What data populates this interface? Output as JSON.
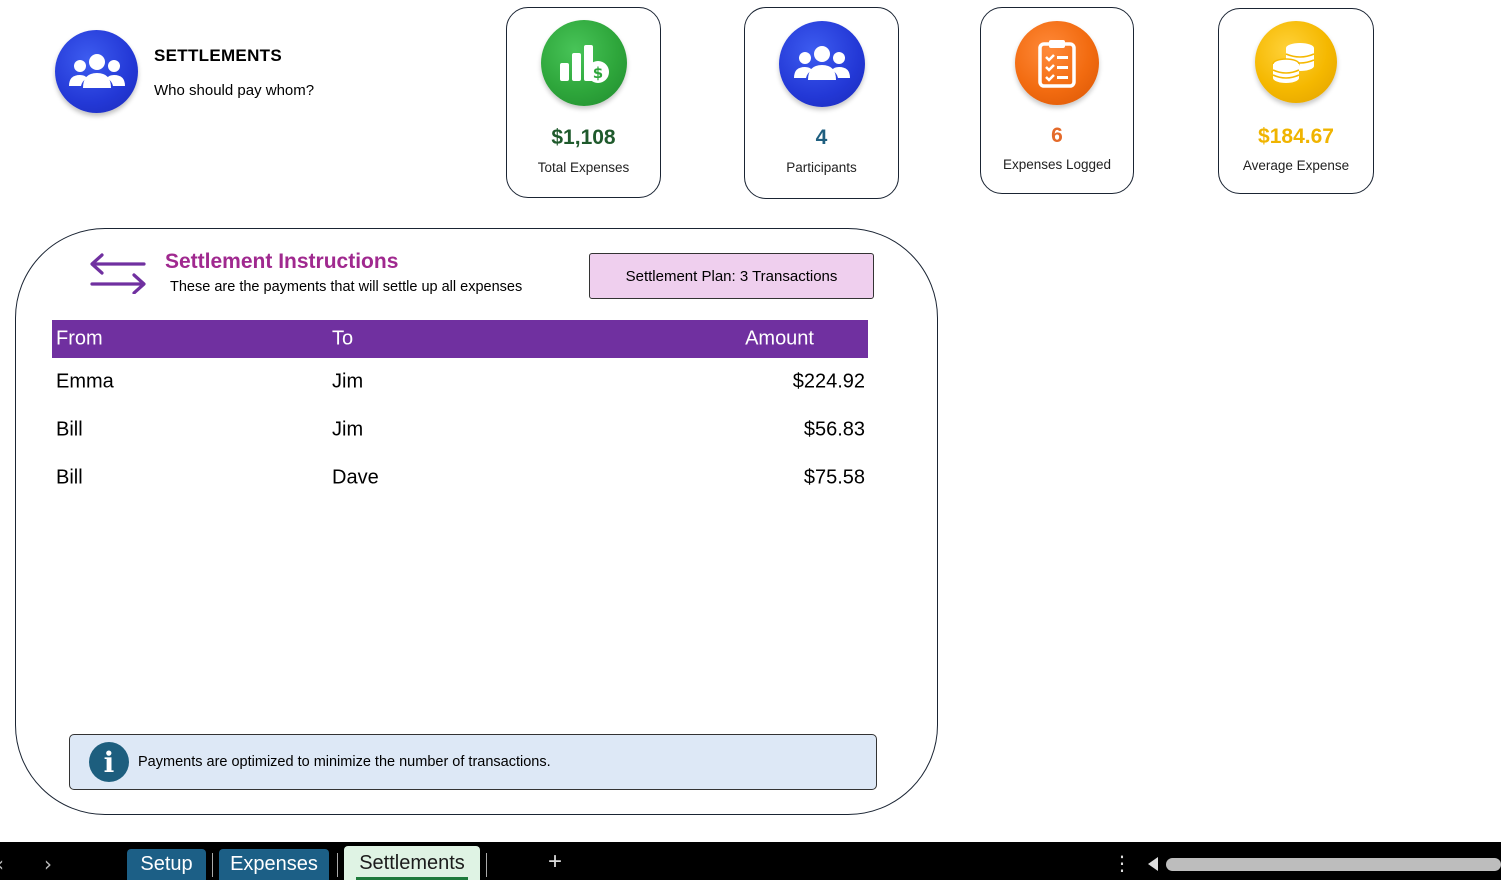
{
  "header": {
    "title": "SETTLEMENTS",
    "subtitle": "Who should pay whom?",
    "icon": "people-group-icon"
  },
  "kpis": [
    {
      "value": "$1,108",
      "label": "Total Expenses",
      "icon": "bar-chart-dollar-icon",
      "color": "#1f5a2c",
      "icon_color": "#2ea63b"
    },
    {
      "value": "4",
      "label": "Participants",
      "icon": "people-group-icon",
      "color": "#1f5f80",
      "icon_color": "#2a3fe0"
    },
    {
      "value": "6",
      "label": "Expenses Logged",
      "icon": "clipboard-checklist-icon",
      "color": "#e46a2a",
      "icon_color": "#f26b10"
    },
    {
      "value": "$184.67",
      "label": "Average Expense",
      "icon": "coins-stack-icon",
      "color": "#f0b400",
      "icon_color": "#f5b800"
    }
  ],
  "settlement": {
    "title": "Settlement Instructions",
    "subtitle": "These are the payments that will settle up all expenses",
    "plan_badge": "Settlement Plan: 3 Transactions",
    "columns": {
      "from": "From",
      "to": "To",
      "amount": "Amount"
    },
    "rows": [
      {
        "from": "Emma",
        "to": "Jim",
        "amount": "$224.92"
      },
      {
        "from": "Bill",
        "to": "Jim",
        "amount": "$56.83"
      },
      {
        "from": "Bill",
        "to": "Dave",
        "amount": "$75.58"
      }
    ],
    "info_text": "Payments are optimized to minimize the number of transactions.",
    "info_icon_glyph": "i",
    "title_color": "#a0298f",
    "header_color": "#7030a0"
  },
  "tabs": {
    "prev_glyph": "‹",
    "next_glyph": "›",
    "items": [
      "Setup",
      "Expenses",
      "Settlements"
    ],
    "active": "Settlements",
    "add_glyph": "+",
    "more_glyph": "⋮"
  }
}
